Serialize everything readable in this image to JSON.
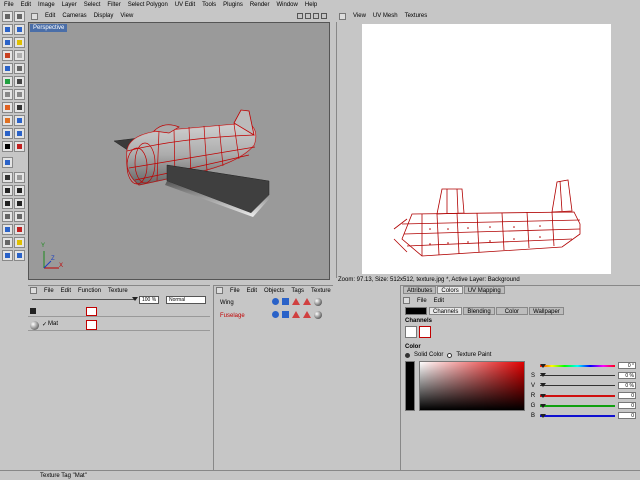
{
  "menubar": [
    "File",
    "Edit",
    "Image",
    "Layer",
    "Select",
    "Filter",
    "Select Polygon",
    "UV Edit",
    "Tools",
    "Plugins",
    "Render",
    "Window",
    "Help"
  ],
  "viewport_persp": {
    "menu": [
      "Edit",
      "Cameras",
      "Display",
      "View"
    ],
    "label": "Perspective",
    "axis_x": "X",
    "axis_y": "Y",
    "axis_z": "Z"
  },
  "viewport_uv": {
    "menu": [
      "View",
      "UV Mesh",
      "Textures"
    ],
    "status": "Zoom: 97.13, Size: 512x512, texture.jpg *, Active Layer: Background"
  },
  "layers_panel": {
    "opacity": "100 %",
    "blend_mode": "Normal",
    "mat_label": "Mat"
  },
  "objects_panel": {
    "menu": [
      "File",
      "Edit",
      "Objects",
      "Tags",
      "Texture"
    ],
    "items": [
      {
        "name": "Wing",
        "color": "#000000"
      },
      {
        "name": "Fuselage",
        "color": "#c00000"
      }
    ]
  },
  "left_panel_menu": [
    "File",
    "Edit",
    "Function",
    "Texture"
  ],
  "attributes": {
    "top_tabs": [
      "Attributes",
      "Colors",
      "UV Mapping"
    ],
    "active_top_tab": "Colors",
    "menu": [
      "File",
      "Edit"
    ],
    "sub_tabs": [
      "Channels",
      "Blending",
      "Color",
      "Wallpaper"
    ],
    "channels_heading": "Channels",
    "color_heading": "Color",
    "radio_solid": "Solid Color",
    "radio_texture": "Texture Paint",
    "sliders": [
      {
        "label": "",
        "value": "0 °",
        "color": "rainbow"
      },
      {
        "label": "S",
        "value": "0 %",
        "color": "#000000"
      },
      {
        "label": "V",
        "value": "0 %",
        "color": "#000000"
      },
      {
        "label": "R",
        "value": "0",
        "color": "#d01010"
      },
      {
        "label": "G",
        "value": "0",
        "color": "#10a010"
      },
      {
        "label": "B",
        "value": "0",
        "color": "#1010d0"
      }
    ]
  },
  "statusbar": "Texture Tag \"Mat\"",
  "colors": {
    "wire": "#c00000",
    "viewport_bg": "#9a9a9a",
    "accent": "#4a6ea8"
  }
}
